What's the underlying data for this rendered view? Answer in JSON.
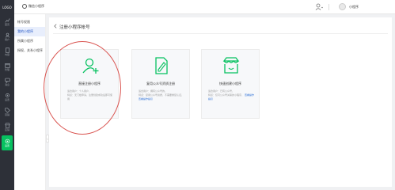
{
  "rail": {
    "logo": "LOGO",
    "items": [
      {
        "label": "首页",
        "icon": "chart-icon"
      },
      {
        "label": "用户",
        "icon": "users-icon"
      },
      {
        "label": "内容",
        "icon": "file-icon"
      },
      {
        "label": "管理",
        "icon": "calendar-icon"
      },
      {
        "label": "消息",
        "icon": "chat-icon"
      },
      {
        "label": "设置",
        "icon": "gear-icon"
      },
      {
        "label": "营销",
        "icon": "tag-icon"
      },
      {
        "label": "店铺",
        "icon": "shop-icon"
      },
      {
        "label": "设置",
        "icon": "settings-icon",
        "active": true
      }
    ],
    "accent": "#07c160",
    "background": "#2d3038"
  },
  "topbar": {
    "brand": "微信小程序",
    "username": "小程序"
  },
  "subnav": {
    "items": [
      {
        "label": "帐号权限"
      },
      {
        "label": "我的小程序",
        "active": true
      },
      {
        "label": "所属小程序"
      },
      {
        "label": "授权、关系小程序"
      }
    ]
  },
  "main": {
    "title": "注册小程序帐号",
    "cards": [
      {
        "title": "直接注册小程序",
        "desc": "适合用户：个人用户、\n特点：无门槛申请，注册创建成功后即可使用",
        "link": ""
      },
      {
        "title": "复用公众号资质注册",
        "desc": "适合用户：拥有公众号的，\n特点：复用公众号资质，不需要重复认证，",
        "link": "查看操作指引"
      },
      {
        "title": "快速创建小程序",
        "desc": "适合用户：已有公众号，\n特点：仅可公众号关联的小程序，",
        "link": "查看操作指引"
      }
    ]
  },
  "highlight_color": "#d9534f"
}
